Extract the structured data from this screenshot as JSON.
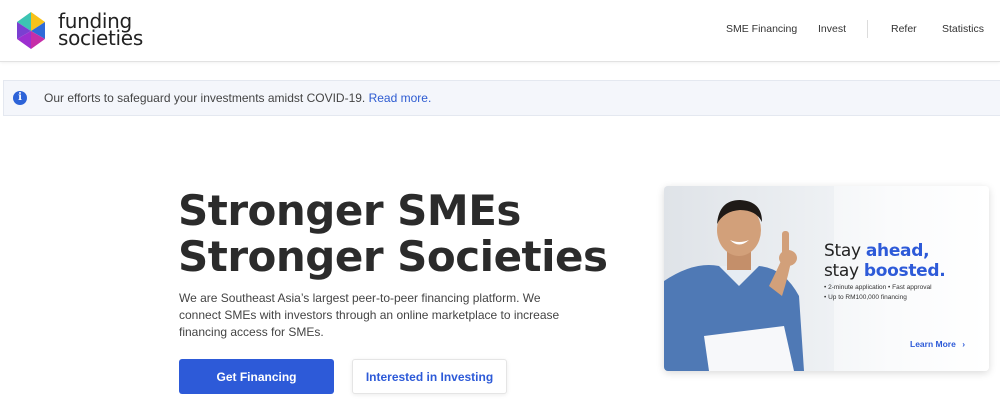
{
  "header": {
    "logo": {
      "line1": "funding",
      "line2": "societies"
    },
    "nav": [
      {
        "label": "SME Financing"
      },
      {
        "label": "Invest"
      },
      {
        "label": "Refer"
      },
      {
        "label": "Statistics"
      }
    ]
  },
  "notice": {
    "icon": "info-icon",
    "text": "Our efforts to safeguard your investments amidst COVID-19. ",
    "link": "Read more."
  },
  "hero": {
    "title_line1": "Stronger SMEs",
    "title_line2": "Stronger Societies",
    "description": "We are Southeast Asia’s largest peer-to-peer financing platform. We connect SMEs with investors through an online marketplace to increase financing access for SMEs.",
    "primary_button": "Get Financing",
    "secondary_button": "Interested in Investing"
  },
  "promo": {
    "headline_pre": "Stay ",
    "headline_em1": "ahead,",
    "headline_line2_pre": "stay ",
    "headline_em2": "boosted.",
    "bullet1": "• 2-minute application  • Fast approval",
    "bullet2": "• Up to RM100,000 financing",
    "cta": "Learn More",
    "cta_icon": "chevron-right-icon"
  },
  "colors": {
    "accent": "#2d5ad8",
    "notice_bg": "#f4f6fb"
  }
}
